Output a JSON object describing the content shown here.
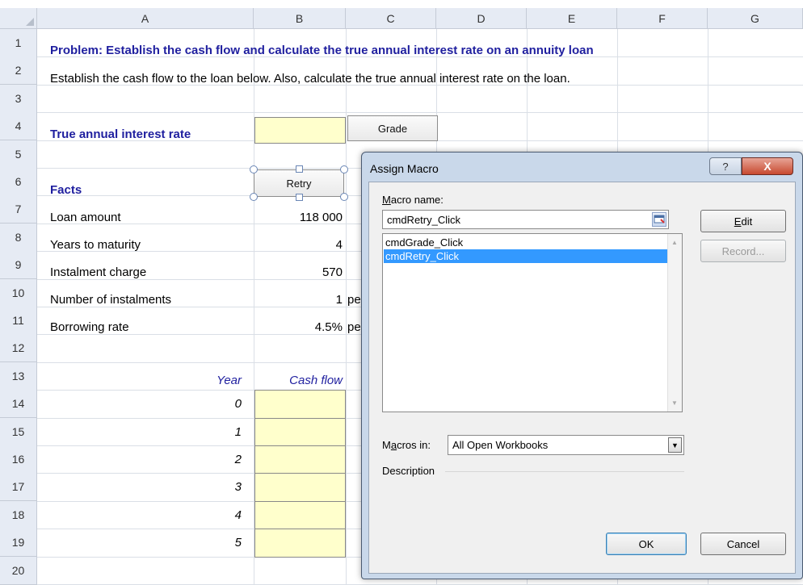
{
  "columns": [
    "A",
    "B",
    "C",
    "D",
    "E",
    "F",
    "G"
  ],
  "rows": [
    "1",
    "2",
    "3",
    "4",
    "5",
    "6",
    "7",
    "8",
    "9",
    "10",
    "11",
    "12",
    "13",
    "14",
    "15",
    "16",
    "17",
    "18",
    "19",
    "20"
  ],
  "cells": {
    "r1": "Problem: Establish the cash flow and calculate the true annual interest rate on an annuity loan",
    "r2": "Establish the cash flow to the loan below.  Also, calculate the true annual interest rate on the loan.",
    "r4_label": "True annual interest rate",
    "r6_label": "Facts",
    "r7_label": "Loan amount",
    "r7_value": "118 000",
    "r8_label": "Years to maturity",
    "r8_value": "4",
    "r9_label": "Instalment charge",
    "r9_value": "570",
    "r10_label": "Number of instalments",
    "r10_value": "1",
    "r10_unit": "pe",
    "r11_label": "Borrowing rate",
    "r11_value": "4.5%",
    "r11_unit": "pe",
    "r13_year": "Year",
    "r13_cashflow": "Cash flow",
    "years": [
      "0",
      "1",
      "2",
      "3",
      "4",
      "5"
    ]
  },
  "buttons": {
    "grade": "Grade",
    "retry": "Retry"
  },
  "dialog": {
    "title": "Assign Macro",
    "help_glyph": "?",
    "close_glyph": "X",
    "macro_name_label_u": "M",
    "macro_name_label_rest": "acro name:",
    "macro_name_value": "cmdRetry_Click",
    "macros": [
      "cmdGrade_Click",
      "cmdRetry_Click"
    ],
    "selected_macro": "cmdRetry_Click",
    "macros_in_label_pre": "M",
    "macros_in_label_u": "a",
    "macros_in_label_rest": "cros in:",
    "macros_in_value": "All Open Workbooks",
    "description_label": "Description",
    "edit_u": "E",
    "edit_rest": "dit",
    "record_label": "Record...",
    "ok_label": "OK",
    "cancel_label": "Cancel"
  },
  "colors": {
    "input_fill": "#ffffcc",
    "header_fill": "#e6ebf4",
    "title_blue": "#1f1f9f",
    "selection": "#3399ff"
  }
}
